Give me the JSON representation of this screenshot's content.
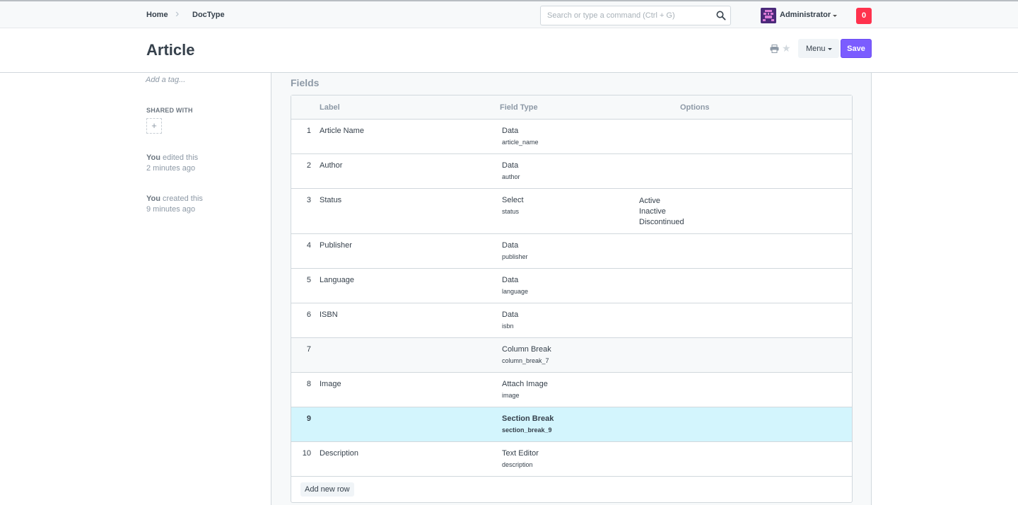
{
  "navbar": {
    "breadcrumbs": [
      "Home",
      "DocType"
    ],
    "search_placeholder": "Search or type a command (Ctrl + G)",
    "user_name": "Administrator",
    "notification_count": "0"
  },
  "page": {
    "title": "Article",
    "menu_label": "Menu",
    "save_label": "Save"
  },
  "sidebar": {
    "add_tag": "Add a tag...",
    "shared_with": "SHARED WITH",
    "share_add": "+",
    "activity": [
      {
        "who": "You",
        "what": "edited this",
        "when": "2 minutes ago"
      },
      {
        "who": "You",
        "what": "created this",
        "when": "9 minutes ago"
      }
    ]
  },
  "fields_section": {
    "title": "Fields",
    "columns": [
      "Label",
      "Field Type",
      "Options"
    ],
    "rows": [
      {
        "idx": "1",
        "label": "Article Name",
        "fieldtype": "Data",
        "fieldname": "article_name",
        "options": []
      },
      {
        "idx": "2",
        "label": "Author",
        "fieldtype": "Data",
        "fieldname": "author",
        "options": []
      },
      {
        "idx": "3",
        "label": "Status",
        "fieldtype": "Select",
        "fieldname": "status",
        "options": [
          "Active",
          "Inactive",
          "Discontinued"
        ]
      },
      {
        "idx": "4",
        "label": "Publisher",
        "fieldtype": "Data",
        "fieldname": "publisher",
        "options": []
      },
      {
        "idx": "5",
        "label": "Language",
        "fieldtype": "Data",
        "fieldname": "language",
        "options": []
      },
      {
        "idx": "6",
        "label": "ISBN",
        "fieldtype": "Data",
        "fieldname": "isbn",
        "options": []
      },
      {
        "idx": "7",
        "label": "",
        "fieldtype": "Column Break",
        "fieldname": "column_break_7",
        "options": []
      },
      {
        "idx": "8",
        "label": "Image",
        "fieldtype": "Attach Image",
        "fieldname": "image",
        "options": []
      },
      {
        "idx": "9",
        "label": "",
        "fieldtype": "Section Break",
        "fieldname": "section_break_9",
        "options": []
      },
      {
        "idx": "10",
        "label": "Description",
        "fieldtype": "Text Editor",
        "fieldname": "description",
        "options": []
      }
    ],
    "add_row_label": "Add new row"
  },
  "colors": {
    "primary": "#7b5cff",
    "notification": "#ff324d",
    "highlight_row": "#d3f5fd"
  }
}
